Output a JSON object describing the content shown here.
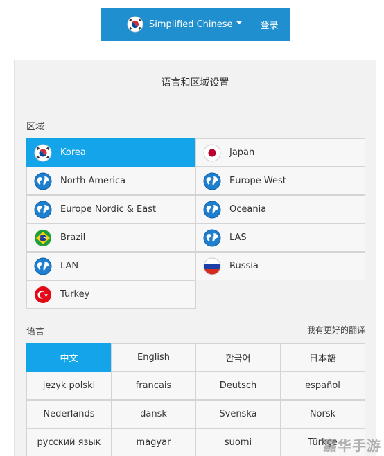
{
  "topbar": {
    "language": "Simplified Chinese",
    "login": "登录"
  },
  "panel": {
    "title": "语言和区域设置"
  },
  "region": {
    "label": "区域",
    "items": [
      {
        "label": "Korea",
        "icon": "korea-flag-icon",
        "selected": true
      },
      {
        "label": "Japan",
        "icon": "japan-flag-icon",
        "underlined": true
      },
      {
        "label": "North America",
        "icon": "globe-icon"
      },
      {
        "label": "Europe West",
        "icon": "globe-icon"
      },
      {
        "label": "Europe Nordic & East",
        "icon": "globe-icon"
      },
      {
        "label": "Oceania",
        "icon": "globe-icon"
      },
      {
        "label": "Brazil",
        "icon": "brazil-flag-icon"
      },
      {
        "label": "LAS",
        "icon": "globe-icon"
      },
      {
        "label": "LAN",
        "icon": "globe-icon"
      },
      {
        "label": "Russia",
        "icon": "russia-flag-icon"
      },
      {
        "label": "Turkey",
        "icon": "turkey-flag-icon"
      }
    ]
  },
  "language": {
    "label": "语言",
    "better_translation": "我有更好的翻译",
    "items": [
      {
        "label": "中文",
        "selected": true
      },
      {
        "label": "English"
      },
      {
        "label": "한국어"
      },
      {
        "label": "日本語"
      },
      {
        "label": "język polski"
      },
      {
        "label": "français"
      },
      {
        "label": "Deutsch"
      },
      {
        "label": "español"
      },
      {
        "label": "Nederlands"
      },
      {
        "label": "dansk"
      },
      {
        "label": "Svenska"
      },
      {
        "label": "Norsk"
      },
      {
        "label": "русский язык"
      },
      {
        "label": "magyar"
      },
      {
        "label": "suomi"
      },
      {
        "label": "Türkçe"
      }
    ]
  },
  "watermark": "嘉华手游",
  "colors": {
    "topbar": "#1f8fd0",
    "selected": "#13a4ea",
    "panel": "#f2f2f2",
    "cell": "#f7f7f7",
    "border": "#d4d4d4"
  }
}
